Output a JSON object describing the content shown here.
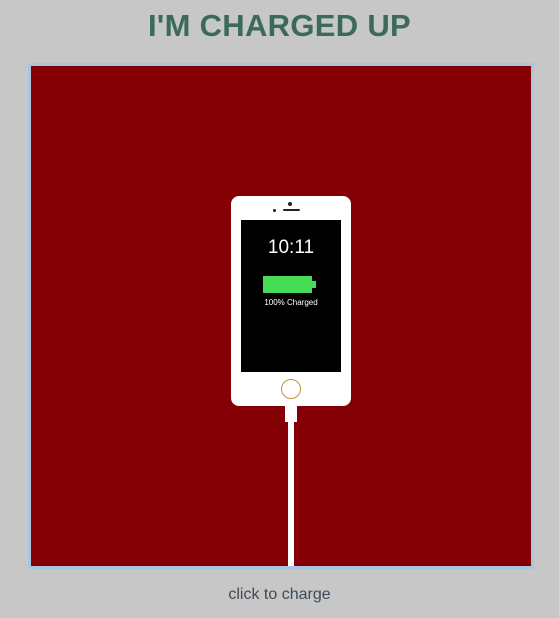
{
  "header": {
    "title": "I'M CHARGED UP"
  },
  "phone": {
    "time": "10:11",
    "battery_status": "100% Charged",
    "battery_level_percent": 100
  },
  "footer": {
    "action_label": "click to charge"
  },
  "colors": {
    "background": "#c7c7c7",
    "title": "#3b6a5d",
    "stage": "#840005",
    "stage_border": "#a9c6de",
    "battery": "#44dd55",
    "home_button_ring": "#b8963a"
  },
  "icons": {
    "battery": "battery-full-icon",
    "home": "home-button-icon"
  }
}
